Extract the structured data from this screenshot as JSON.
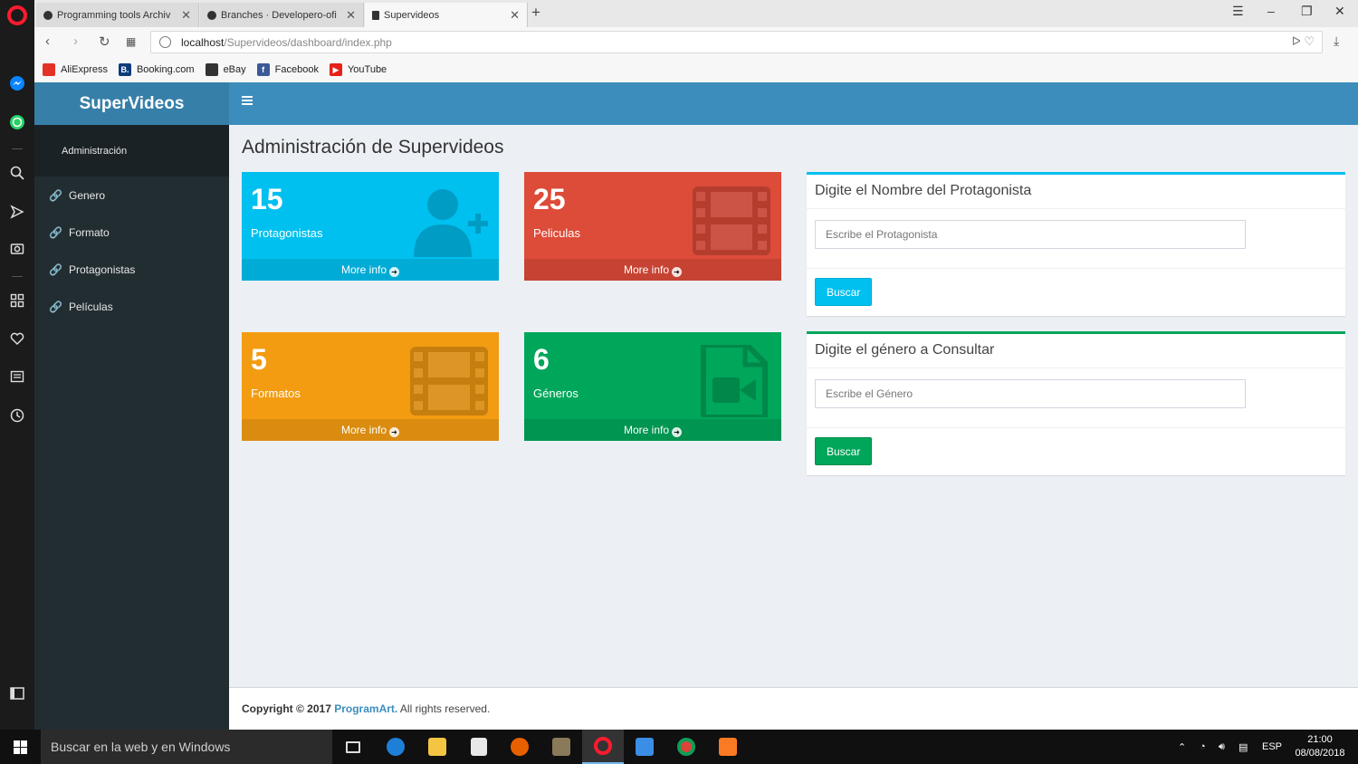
{
  "browser": {
    "tabs": [
      {
        "title": "Programming tools Archiv",
        "active": false
      },
      {
        "title": "Branches · Developero-ofi",
        "active": false
      },
      {
        "title": "Supervideos",
        "active": true
      }
    ],
    "url_host": "localhost",
    "url_path": "/Supervideos/dashboard/index.php",
    "bookmarks": [
      {
        "label": "AliExpress",
        "icon": "aliexpress-icon",
        "color": "#e43225"
      },
      {
        "label": "Booking.com",
        "icon": "booking-icon",
        "color": "#0c3b7c"
      },
      {
        "label": "eBay",
        "icon": "ebay-icon",
        "color": "#333333"
      },
      {
        "label": "Facebook",
        "icon": "facebook-icon",
        "color": "#3b5998"
      },
      {
        "label": "YouTube",
        "icon": "youtube-icon",
        "color": "#e62117"
      }
    ]
  },
  "app": {
    "brand": "SuperVideos",
    "sidebar": {
      "header": "Administración",
      "items": [
        {
          "label": "Genero",
          "icon": "link-icon"
        },
        {
          "label": "Formato",
          "icon": "link-icon"
        },
        {
          "label": "Protagonistas",
          "icon": "link-icon"
        },
        {
          "label": "Películas",
          "icon": "link-icon"
        }
      ]
    },
    "page_title": "Administración de Supervideos",
    "stat_boxes": [
      {
        "count": "15",
        "label": "Protagonistas",
        "more": "More info",
        "color": "#00c0ef",
        "icon": "user-plus-icon"
      },
      {
        "count": "25",
        "label": "Peliculas",
        "more": "More info",
        "color": "#dd4b39",
        "icon": "film-icon"
      },
      {
        "count": "5",
        "label": "Formatos",
        "more": "More info",
        "color": "#f39c12",
        "icon": "film-icon"
      },
      {
        "count": "6",
        "label": "Géneros",
        "more": "More info",
        "color": "#00a65a",
        "icon": "video-file-icon"
      }
    ],
    "search_protagonista": {
      "title": "Digite el Nombre del Protagonista",
      "placeholder": "Escribe el Protagonista",
      "button": "Buscar",
      "accent": "#00c0ef"
    },
    "search_genero": {
      "title": "Digite el género a Consultar",
      "placeholder": "Escribe el Género",
      "button": "Buscar",
      "accent": "#00a65a"
    },
    "footer": {
      "copyright": "Copyright © 2017",
      "brand": "ProgramArt.",
      "rights": "All rights reserved."
    }
  },
  "taskbar": {
    "search_placeholder": "Buscar en la web y en Windows",
    "language": "ESP",
    "time": "21:00",
    "date": "08/08/2018"
  }
}
